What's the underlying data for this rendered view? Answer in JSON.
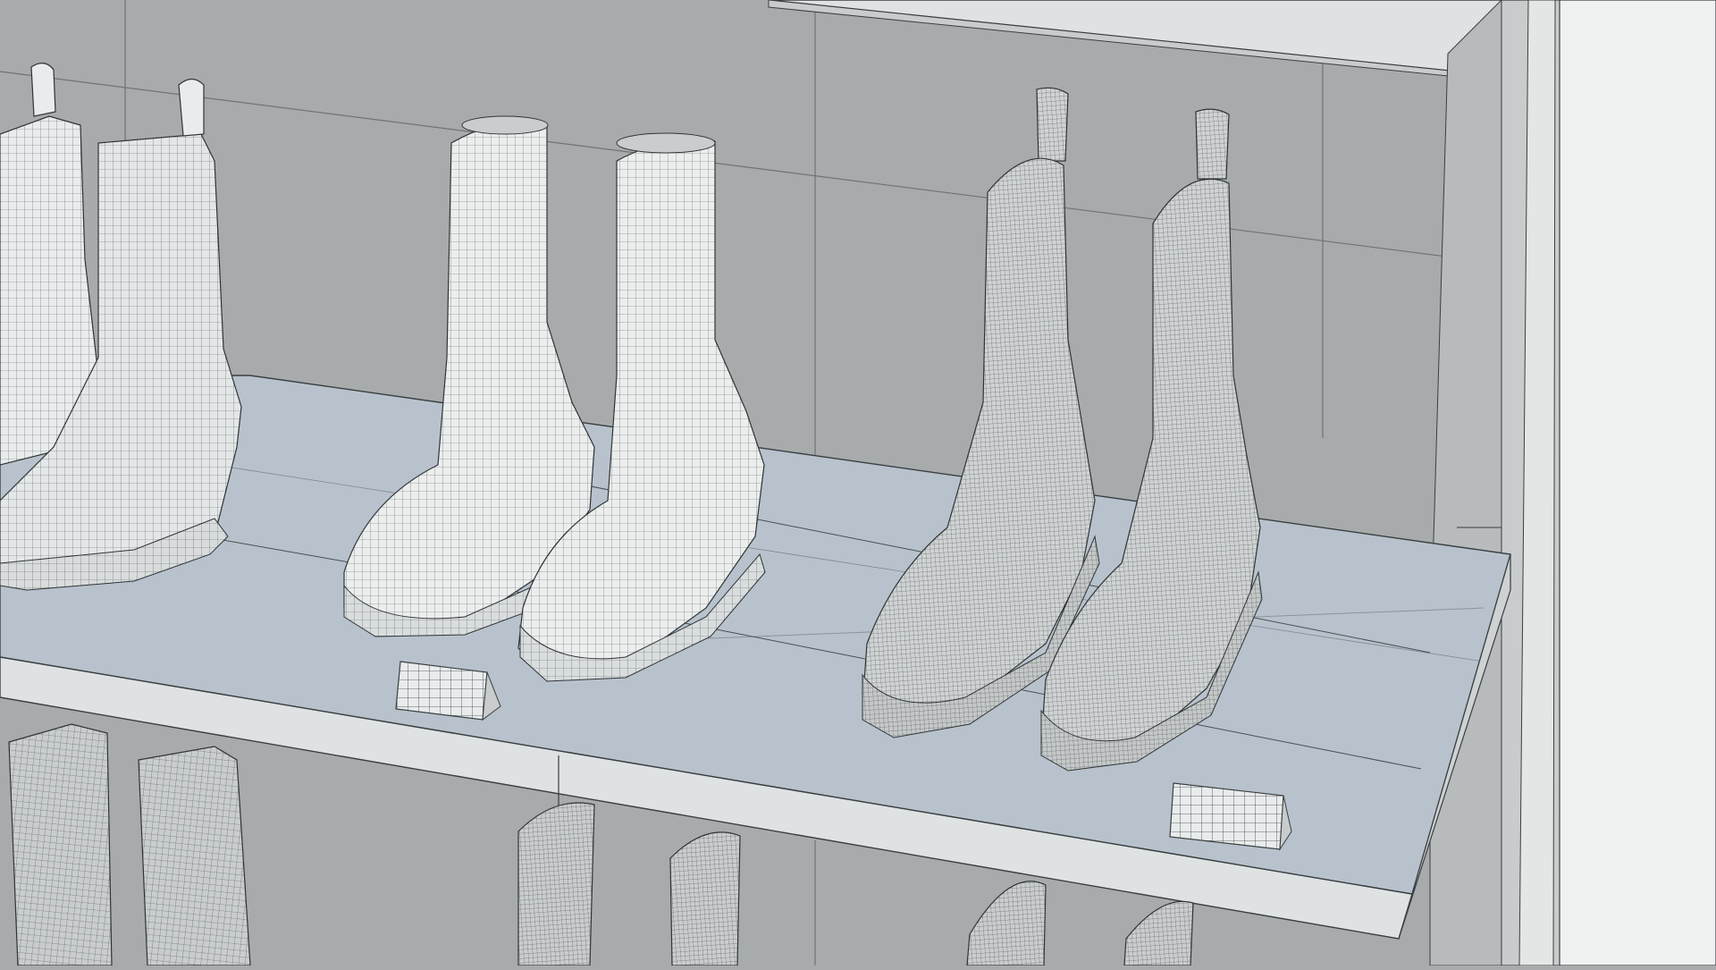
{
  "scene": {
    "subject": "boots-on-shelf-wireframe-render",
    "colors": {
      "wall": "#a8abab",
      "wall_right": "#b2b5b5",
      "shelf_top": "#b7c2cc",
      "shelf_front": "#dfe2e3",
      "side_panel": "#e8eaea",
      "boot_light": "#e9ecec",
      "boot_mid": "#d2d6d6",
      "boot_dark": "#c4c8c8",
      "wire": "#303437",
      "edge": "#3a3e40"
    },
    "icons": [
      "boot-icon",
      "price-tag-icon"
    ]
  }
}
